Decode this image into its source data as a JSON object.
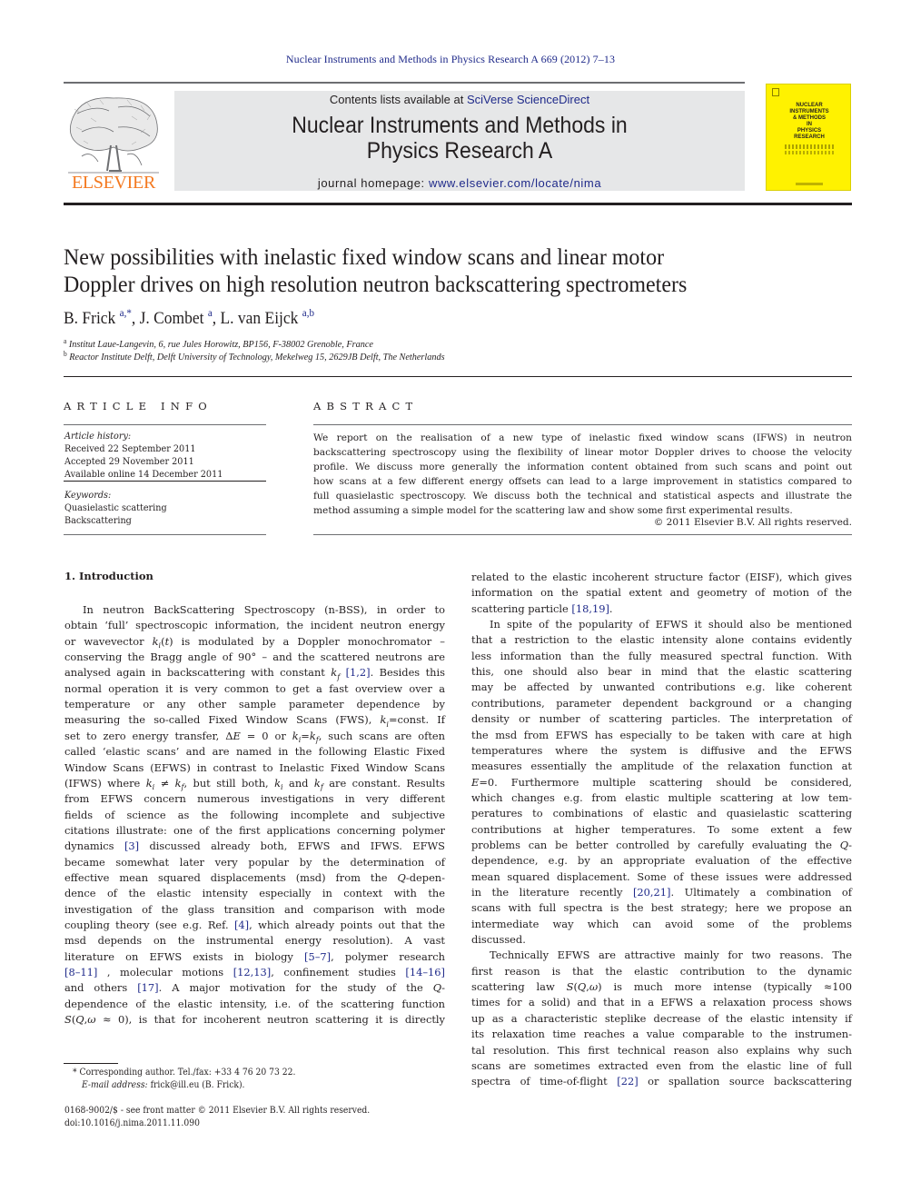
{
  "running_head": "Nuclear Instruments and Methods in Physics Research A 669 (2012) 7–13",
  "masthead": {
    "publisher_wordmark": "ELSEVIER",
    "publisher_logo_icon": "elsevier-tree-icon",
    "contents_prefix": "Contents lists available at ",
    "contents_link": "SciVerse ScienceDirect",
    "journal_title_line1": "Nuclear Instruments and Methods in",
    "journal_title_line2": "Physics Research A",
    "homepage_prefix": "journal homepage: ",
    "homepage_link": "www.elsevier.com/locate/nima",
    "cover_title": "NUCLEAR\nINSTRUMENTS\n& METHODS\nIN\nPHYSICS\nRESEARCH",
    "colors": {
      "elsevier_orange": "#f47920",
      "link_blue": "#1f2a8a",
      "cover_yellow": "#fff200",
      "masthead_gray": "#e6e7e8"
    }
  },
  "article": {
    "title_line1": "New possibilities with inelastic fixed window scans and linear motor",
    "title_line2": "Doppler drives on high resolution neutron backscattering spectrometers",
    "authors": [
      {
        "name": "B. Frick",
        "sup": "a,*",
        "sep": ", "
      },
      {
        "name": "J. Combet",
        "sup": "a",
        "sep": ", "
      },
      {
        "name": "L. van Eijck",
        "sup": "a,b",
        "sep": ""
      }
    ],
    "affiliations": [
      {
        "mark": "a",
        "text": "Institut Laue-Langevin, 6, rue Jules Horowitz, BP156, F-38002 Grenoble, France"
      },
      {
        "mark": "b",
        "text": "Reactor Institute Delft, Delft University of Technology, Mekelweg 15, 2629JB Delft, The Netherlands"
      }
    ]
  },
  "article_info": {
    "heading": "ARTICLE INFO",
    "history_label": "Article history:",
    "received": "Received 22 September 2011",
    "accepted": "Accepted 29 November 2011",
    "available": "Available online 14 December 2011",
    "keywords_label": "Keywords:",
    "keywords": [
      "Quasielastic scattering",
      "Backscattering"
    ]
  },
  "abstract": {
    "heading": "ABSTRACT",
    "lines": [
      "We report on the realisation of a new type of inelastic fixed window scans (IFWS) in neutron",
      "backscattering spectroscopy using the flexibility of linear motor Doppler drives to choose the velocity",
      "profile. We discuss more generally the information content obtained from such scans and point out",
      "how scans at a few different energy offsets can lead to a large improvement in statistics compared to",
      "full quasielastic spectroscopy. We discuss both the technical and statistical aspects and illustrate the",
      "method assuming a simple model for the scattering law and show some first experimental results."
    ],
    "copyright": "© 2011 Elsevier B.V. All rights reserved."
  },
  "body": {
    "section_heading": "1.   Introduction",
    "left_column": [
      "In neutron BackScattering Spectroscopy (n-BSS), in order to",
      "obtain ‘full’ spectroscopic information, the incident neutron energy",
      "or wavevector k<sub>i</sub>(t) is modulated by a Doppler monochromator –",
      "conserving the Bragg angle of 90° – and the scattered neutrons are",
      "analysed again in backscattering with constant k<sub>f</sub> [1,2]. Besides this",
      "normal operation it is very common to get a fast overview over a",
      "temperature or any other sample parameter dependence by",
      "measuring the so-called Fixed Window Scans (FWS), k<sub>i</sub>=const. If",
      "set to zero energy transfer, ΔE = 0 or k<sub>i</sub>=k<sub>f</sub>, such scans are often",
      "called ‘elastic scans’ and are named in the following Elastic Fixed",
      "Window Scans (EFWS) in contrast to Inelastic Fixed Window Scans",
      "(IFWS) where k<sub>i</sub> ≠ k<sub>f</sub>, but still both, k<sub>i</sub> and k<sub>f</sub> are constant. Results",
      "from EFWS concern numerous investigations in very different",
      "fields of science as the following incomplete and subjective",
      "citations illustrate: one of the first applications concerning polymer",
      "dynamics [3] discussed already both, EFWS and IFWS. EFWS",
      "became somewhat later very popular by the determination of",
      "effective mean squared displacements (msd) from the Q-depen-",
      "dence of the elastic intensity especially in context with the",
      "investigation of the glass transition and comparison with mode",
      "coupling theory (see e.g. Ref. [4], which already points out that the",
      "msd depends on the instrumental energy resolution). A vast",
      "literature on EFWS exists in biology [5–7], polymer research",
      "[8–11] , molecular motions [12,13], confinement studies [14–16]",
      "and others [17]. A major motivation for the study of the Q-",
      "dependence of the elastic intensity, i.e. of the scattering function",
      "S(Q,ω ≈ 0), is that for incoherent neutron scattering it is directly"
    ],
    "right_column": [
      "related to the elastic incoherent structure factor (EISF), which gives",
      "information on the spatial extent and geometry of motion of the",
      "scattering particle [18,19].",
      "In spite of the popularity of EFWS it should also be mentioned",
      "that a restriction to the elastic intensity alone contains evidently",
      "less information than the fully measured spectral function. With",
      "this, one should also bear in mind that the elastic scattering",
      "may be affected by unwanted contributions e.g. like coherent",
      "contributions, parameter dependent background or a changing",
      "density or number of scattering particles. The interpretation of",
      "the msd from EFWS has especially to be taken with care at high",
      "temperatures where the system is diffusive and the EFWS",
      "measures essentially the amplitude of the relaxation function at",
      "E=0. Furthermore multiple scattering should be considered,",
      "which changes e.g. from elastic multiple scattering at low tem-",
      "peratures to combinations of elastic and quasielastic scattering",
      "contributions at higher temperatures. To some extent a few",
      "problems can be better controlled by carefully evaluating the Q-",
      "dependence, e.g. by an appropriate evaluation of the effective",
      "mean squared displacement. Some of these issues were addressed",
      "in the literature recently [20,21]. Ultimately a combination of",
      "scans with full spectra is the best strategy; here we propose an",
      "intermediate way which can avoid some of the problems",
      "discussed.",
      "Technically EFWS are attractive mainly for two reasons. The",
      "first reason is that the elastic contribution to the dynamic",
      "scattering law S(Q,ω) is much more intense (typically ≈100",
      "times for a solid) and that in a EFWS a relaxation process shows",
      "up as a characteristic steplike decrease of the elastic intensity if",
      "its relaxation time reaches a value comparable to the instrumen-",
      "tal resolution. This first technical reason also explains why such",
      "scans are sometimes extracted even from the elastic line of full",
      "spectra of time-of-flight [22] or spallation source backscattering"
    ]
  },
  "footnotes": {
    "corresponding": "* Corresponding author. Tel./fax: +33 4 76 20 73 22.",
    "email_label": "E-mail address:",
    "email_value": " frick@ill.eu (B. Frick).",
    "front_matter": "0168-9002/$ - see front matter © 2011 Elsevier B.V. All rights reserved.",
    "doi": "doi:10.1016/j.nima.2011.11.090"
  }
}
